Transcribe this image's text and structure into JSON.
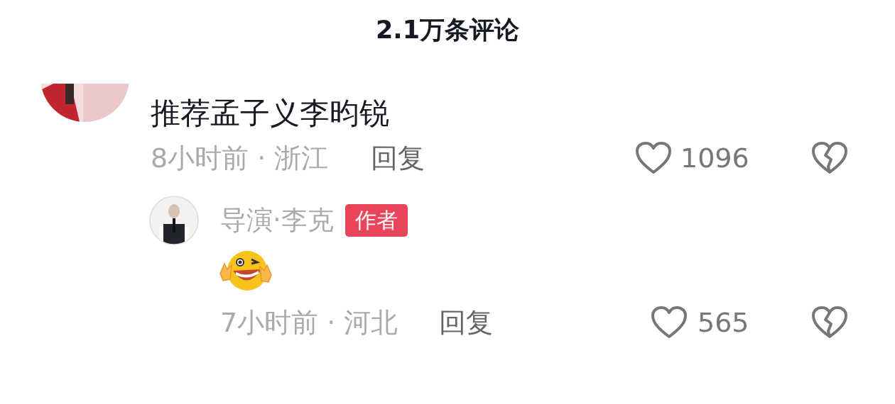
{
  "header": {
    "title": "2.1万条评论"
  },
  "comments": [
    {
      "text": "推荐孟子义李昀锐",
      "time_location": "8小时前 · 浙江",
      "reply_label": "回复",
      "likes": "1096",
      "replies": [
        {
          "author": "导演·李克",
          "badge": "作者",
          "time_location": "7小时前 · 河北",
          "reply_label": "回复",
          "likes": "565"
        }
      ]
    }
  ]
}
